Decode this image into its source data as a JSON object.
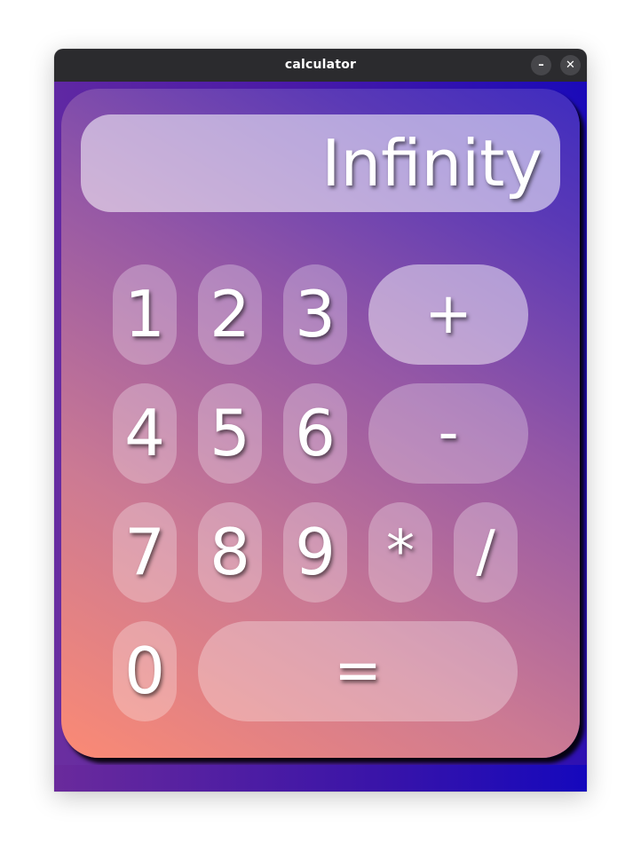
{
  "window": {
    "title": "calculator",
    "minimize_label": "–",
    "close_label": "✕"
  },
  "display": {
    "value": "Infinity"
  },
  "keys": {
    "k1": "1",
    "k2": "2",
    "k3": "3",
    "k4": "4",
    "k5": "5",
    "k6": "6",
    "k7": "7",
    "k8": "8",
    "k9": "9",
    "k0": "0",
    "plus": "+",
    "minus": "-",
    "multiply": "*",
    "divide": "/",
    "equals": "="
  },
  "colors": {
    "titlebar": "#2b2b2e",
    "panel_gradient_start": "#fb8a74",
    "panel_gradient_end": "#3f2cbf",
    "background_gradient_start": "#6b2fa0",
    "background_gradient_end": "#1a0ab9",
    "text": "#ffffff"
  }
}
